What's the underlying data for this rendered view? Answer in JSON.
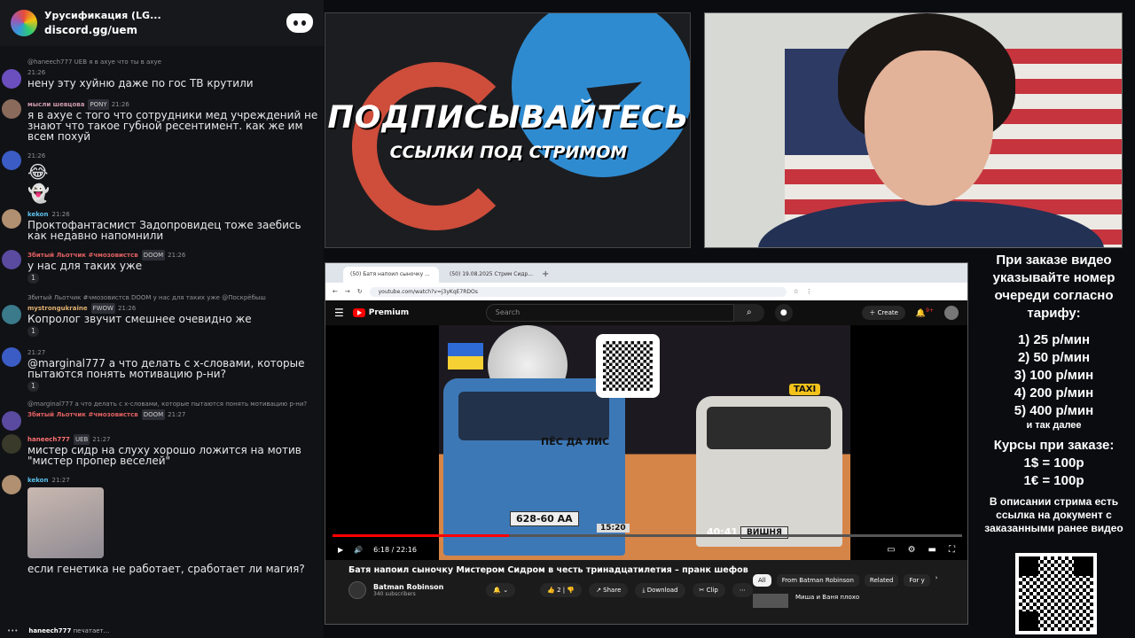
{
  "chat": {
    "server_name": "Урусификация (LG...",
    "server_link": "discord.gg/uem",
    "messages": [
      {
        "reply": "@haneech777 UEB я в ахуе что ты в ахуе",
        "user": "",
        "time": "21:26",
        "text": "нену эту хуйню даже по гос ТВ крутили",
        "avatar_color": "#6b4fbf"
      },
      {
        "reply": "",
        "user": "мысли шевцова",
        "badge": "PONY",
        "time": "21:26",
        "text": "я в ахуе с того что сотрудники мед учреждений не знают что такое губной ресентимент. как же им всем похуй",
        "avatar_color": "#8a6a5a"
      },
      {
        "reply": "",
        "user": "",
        "time": "21:26",
        "text": "",
        "emoji1": "😂",
        "emoji2": "👻",
        "avatar_color": "#3a5cc4"
      },
      {
        "reply": "",
        "user": "kekon",
        "time": "21:26",
        "text": "Проктофантасмист Задопровидец тоже заебись как недавно напомнили",
        "avatar_color": "#b09070"
      },
      {
        "reply": "",
        "user": "Збитый Льотчик #чмозовистсв",
        "badge": "DOOM",
        "time": "21:26",
        "text": "у нас для таких уже",
        "reacts": [
          "1"
        ],
        "avatar_color": "#5a4aa0"
      },
      {
        "reply": "Збитый Льотчик #чмозовистсв DOOM у нас для таких уже @Поскрёбыш",
        "user": "mystrongukraine",
        "badge": "FWOW",
        "time": "21:26",
        "text": "Копролог звучит смешнее очевидно же",
        "reacts": [
          "1"
        ],
        "avatar_color": "#3a7a8a"
      },
      {
        "reply": "",
        "user": "",
        "time": "21:27",
        "text": "@marginal777 а что делать с х-словами, которые пытаются понять мотивацию р-ни?",
        "reacts": [
          "1"
        ],
        "avatar_color": "#3a5cc4"
      },
      {
        "reply": "@marginal777 а что делать с х-словами, которые пытаются понять мотивацию р-ни?",
        "user": "Збитый Льотчик #чмозовистсв",
        "badge": "DOOM",
        "time": "21:27",
        "text": "",
        "avatar_color": "#5a4aa0"
      },
      {
        "reply": "",
        "user": "haneech777",
        "badge": "UEB",
        "time": "21:27",
        "text": "мистер сидр на слуху хорошо ложится на мотив \"мистер пропер веселей\"",
        "avatar_color": "#3a3a2a"
      },
      {
        "reply": "",
        "user": "kekon",
        "time": "21:27",
        "text": "если генетика не работает, сработает ли магия?",
        "avatar_color": "#b09070"
      }
    ],
    "typing_user": "haneech777",
    "typing_text": "печатает..."
  },
  "promo": {
    "title": "ПОДПИСЫВАЙТЕСЬ",
    "subtitle": "ССЫЛКИ ПОД СТРИМОМ"
  },
  "browser": {
    "tabs": [
      "(50) Батя напоил сыночку ...",
      "(50) 19.08.2025 Стрим Сидр..."
    ],
    "url": "youtube.com/watch?v=j3yKqE7RDOs",
    "search_placeholder": "Search",
    "create_label": "Create",
    "notif_count": "9+",
    "premium_label": "Premium",
    "video": {
      "truck_text": "ПЁС ДА ЛИС",
      "plate1": "628-60 АА",
      "timer": "15:20",
      "time2": "40:41",
      "plate2": "ВИШНЯ",
      "taxi": "TAXI",
      "current_time": "6:18 / 22:16",
      "progress": 0.28
    },
    "title": "Батя напоил сыночку Мистером Сидром в честь тринадцатилетия – пранк шефов",
    "channel": "Batman Robinson",
    "subs": "340 subscribers",
    "likes": "2",
    "share": "Share",
    "download": "Download",
    "clip": "Clip",
    "chips": [
      "All",
      "From Batman Robinson",
      "Related",
      "For y"
    ],
    "side_title": "Миша и Ваня плохо"
  },
  "info": {
    "main": "При заказе видео указывайте номер очереди согласно тарифу:",
    "tariffs": [
      "1) 25 р/мин",
      "2) 50 р/мин",
      "3) 100 р/мин",
      "4) 200 р/мин",
      "5) 400 р/мин"
    ],
    "tariff_more": "и так далее",
    "rates_title": "Курсы при заказе:",
    "rates": [
      "1$ = 100р",
      "1€ = 100р"
    ],
    "doc_note": "В описании стрима есть ссылка на документ с заказанными ранее видео"
  }
}
